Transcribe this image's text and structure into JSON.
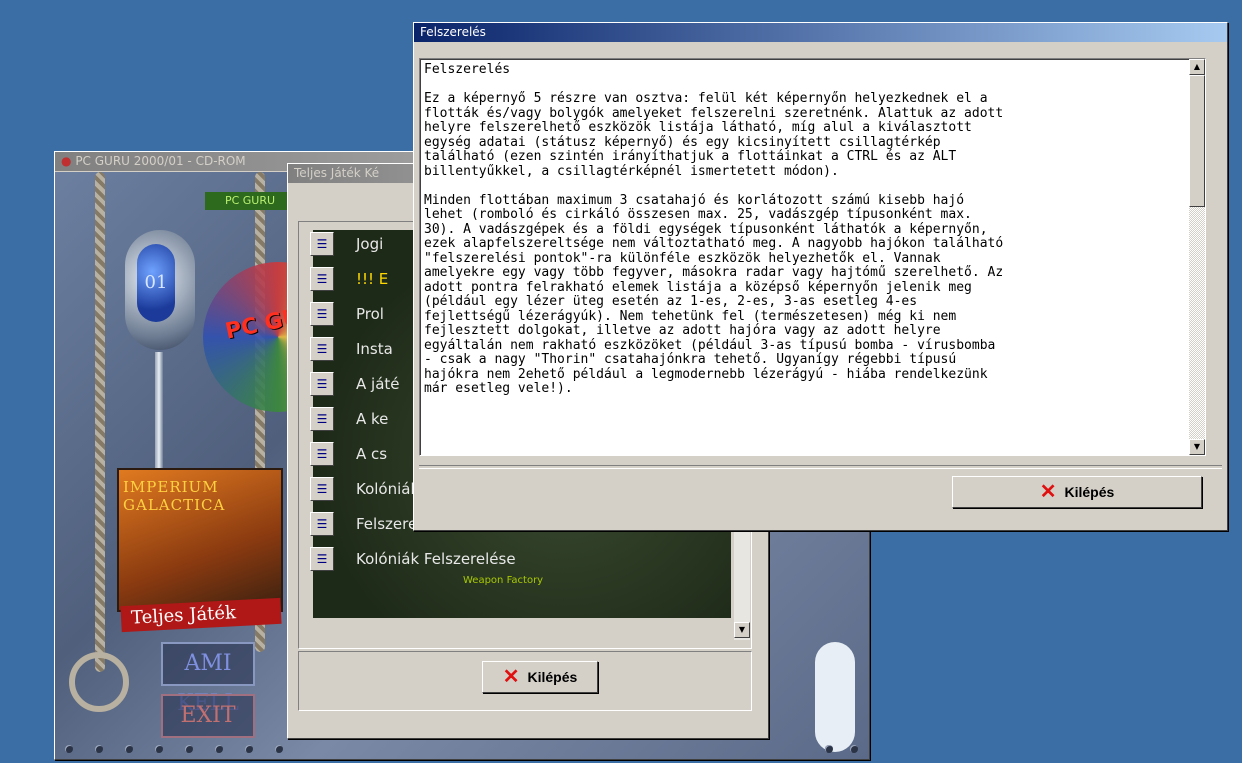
{
  "colors": {
    "desktop": "#3a6ea5",
    "title_active": "#0a246a",
    "kilepes_x": "#e01010",
    "menu_yellow": "#ffd800"
  },
  "background_window": {
    "title": "PC GURU 2000/01 - CD-ROM",
    "cd_text": "PC GU",
    "box_title": "IMPERIUM GALACTICA",
    "red_band": "Teljes Játék",
    "menu_ami_kell": "AMI KELL",
    "menu_exit": "EXIT",
    "brand_strip": "PC GURU"
  },
  "middle_window": {
    "title": "Teljes Játék Ké",
    "items": [
      {
        "label": "Jogi",
        "icon": "document-icon"
      },
      {
        "label": "!!! E",
        "icon": "document-icon"
      },
      {
        "label": "Prol",
        "icon": "document-icon"
      },
      {
        "label": "Insta",
        "icon": "document-icon"
      },
      {
        "label": "A játé",
        "icon": "document-icon"
      },
      {
        "label": "A ke",
        "icon": "document-icon"
      },
      {
        "label": "A cs",
        "icon": "document-icon"
      },
      {
        "label": "Kolóniák",
        "icon": "document-icon"
      },
      {
        "label": "Felszerelés",
        "icon": "document-icon"
      },
      {
        "label": "Kolóniák Felszerelése",
        "icon": "document-icon"
      }
    ],
    "bg_label": "Weapon Factory",
    "exit_label": "Kilépés"
  },
  "front_window": {
    "title": "Felszerelés",
    "heading": "Felszerelés",
    "paragraph1": "Ez a képernyő 5 részre van osztva: felül két képernyőn helyezkednek el a\nflották és/vagy bolygók amelyeket felszerelni szeretnénk. Alattuk az adott\nhelyre felszerelhető eszközök listája látható, míg alul a kiválasztott\negység adatai (státusz képernyő) és egy kicsinyített csillagtérkép\ntalálható (ezen szintén irányíthatjuk a flottáinkat a CTRL és az ALT\nbillentyűkkel, a csillagtérképnél ismertetett módon).",
    "paragraph2": "Minden flottában maximum 3 csatahajó és korlátozott számú kisebb hajó\nlehet (romboló és cirkáló összesen max. 25, vadászgép típusonként max.\n30). A vadászgépek és a földi egységek típusonként láthatók a képernyőn,\nezek alapfelszereltsége nem változtatható meg. A nagyobb hajókon található\n\"felszerelési pontok\"-ra különféle eszközök helyezhetők el. Vannak\namelyekre egy vagy több fegyver, másokra radar vagy hajtómű szerelhető. Az\nadott pontra felrakható elemek listája a középső képernyőn jelenik meg\n(például egy lézer üteg esetén az 1-es, 2-es, 3-as esetleg 4-es\nfejlettségű lézerágyúk). Nem tehetünk fel (természetesen) még ki nem\nfejlesztett dolgokat, illetve az adott hajóra vagy az adott helyre\negyáltalán nem rakható eszközöket (például 3-as típusú bomba - vírusbomba\n- csak a nagy \"Thorin\" csatahajónkra tehető. Ugyanígy régebbi típusú\nhajókra nem 2ehető például a legmodernebb lézerágyú - hiába rendelkezünk\nmár esetleg vele!).",
    "exit_label": "Kilépés"
  }
}
